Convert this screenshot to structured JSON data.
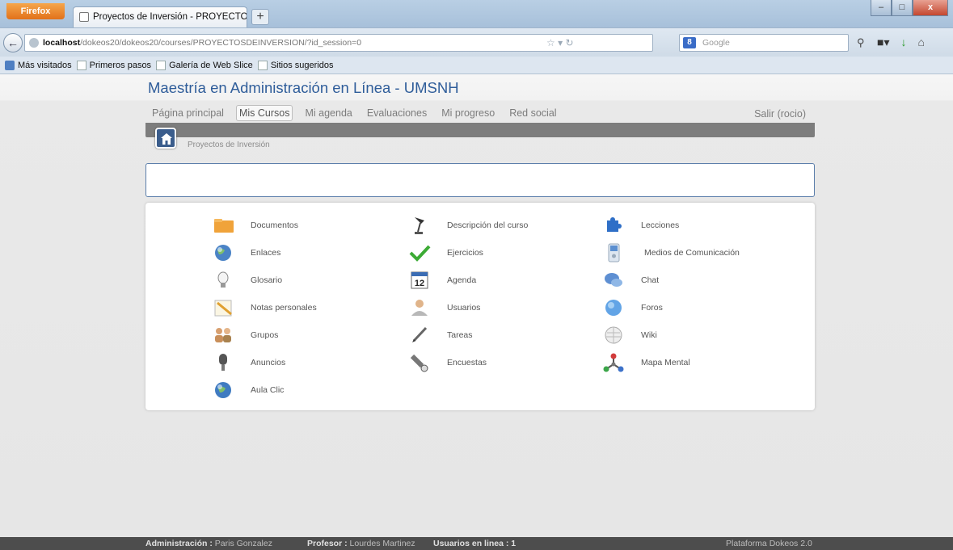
{
  "browser": {
    "app_button": "Firefox",
    "tab_title": "Proyectos de Inversión - PROYECTOSDEL...",
    "new_tab": "+",
    "url_host": "localhost",
    "url_path": "/dokeos20/dokeos20/courses/PROYECTOSDEINVERSION/?id_session=0",
    "search_placeholder": "Google",
    "search_engine": "8",
    "window_controls": {
      "minimize": "–",
      "maximize": "□",
      "close": "x"
    },
    "bookmarks": [
      "Más visitados",
      "Primeros pasos",
      "Galería de Web Slice",
      "Sitios sugeridos"
    ]
  },
  "site": {
    "title": "Maestría en Administración en Línea - UMSNH",
    "menu": [
      "Página principal",
      "Mis Cursos",
      "Mi agenda",
      "Evaluaciones",
      "Mi progreso",
      "Red social"
    ],
    "active_menu": "Mis Cursos",
    "logout": "Salir (rocio)",
    "breadcrumb": "Proyectos de Inversión"
  },
  "tools": {
    "col1": [
      {
        "label": "Documentos",
        "icon": "folder-icon"
      },
      {
        "label": "Enlaces",
        "icon": "globe-link-icon"
      },
      {
        "label": "Glosario",
        "icon": "lightbulb-icon"
      },
      {
        "label": "Notas personales",
        "icon": "notepad-icon"
      },
      {
        "label": "Grupos",
        "icon": "group-users-icon"
      },
      {
        "label": "Anuncios",
        "icon": "microphone-icon"
      },
      {
        "label": "Aula Clic",
        "icon": "globe-icon"
      }
    ],
    "col2": [
      {
        "label": "Descripción del curso",
        "icon": "desk-lamp-icon"
      },
      {
        "label": "Ejercicios",
        "icon": "checkmark-icon"
      },
      {
        "label": "Agenda",
        "icon": "calendar-icon",
        "calendar_day": "12"
      },
      {
        "label": "Usuarios",
        "icon": "user-icon"
      },
      {
        "label": "Tareas",
        "icon": "pen-icon"
      },
      {
        "label": "Encuestas",
        "icon": "flashlight-icon"
      }
    ],
    "col3": [
      {
        "label": "Lecciones",
        "icon": "puzzle-icon"
      },
      {
        "label": "Medios de Comunicación",
        "icon": "media-player-icon"
      },
      {
        "label": "Chat",
        "icon": "chat-bubbles-icon"
      },
      {
        "label": "Foros",
        "icon": "forum-icon"
      },
      {
        "label": "Wiki",
        "icon": "wikipedia-globe-icon"
      },
      {
        "label": "Mapa Mental",
        "icon": "mind-map-icon"
      }
    ]
  },
  "footer": {
    "admin_label": "Administración :",
    "admin_name": "Paris Gonzalez",
    "teacher_label": "Profesor :",
    "teacher_name": "Lourdes Martinez",
    "online_label": "Usuarios en linea :",
    "online_count": "1",
    "platform": "Plataforma Dokeos 2.0"
  },
  "colors": {
    "title_blue": "#2f5d9a",
    "footer_bg": "#4d4d4d",
    "gray_bar": "#7d7d7d"
  }
}
